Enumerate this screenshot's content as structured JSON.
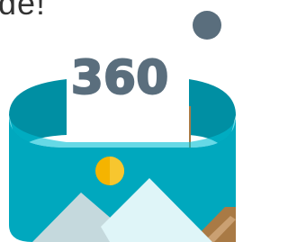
{
  "caption": {
    "text": "de!"
  },
  "panorama_icon": {
    "label": "360",
    "colors": {
      "label": "#5a6e7d",
      "degree_dot": "#5a6e7d",
      "band_outer": "#00a8be",
      "band_inner": "#008fa3",
      "band_back": "#009cb0",
      "sun": "#f5b400",
      "mountain_left": "#c5d9dd",
      "mountain_right": "#dff5f8",
      "photo_wood": "#a97a45",
      "photo_grass": "#7bc243"
    }
  }
}
